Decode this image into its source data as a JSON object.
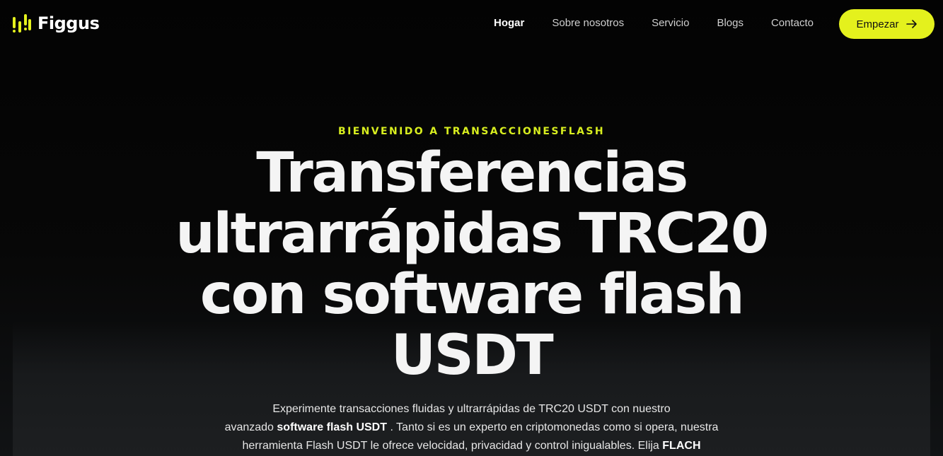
{
  "brand": {
    "name": "Figgus",
    "accent_color": "#E4F11D",
    "logo_icon": "bars-logo-icon"
  },
  "nav": {
    "items": [
      {
        "label": "Hogar",
        "active": true
      },
      {
        "label": "Sobre nosotros",
        "active": false
      },
      {
        "label": "Servicio",
        "active": false
      },
      {
        "label": "Blogs",
        "active": false
      },
      {
        "label": "Contacto",
        "active": false
      }
    ],
    "cta": {
      "label": "Empezar",
      "icon": "arrow-right-icon"
    }
  },
  "hero": {
    "eyebrow": "BIENVENIDO A TRANSACCIONESFLASH",
    "title_lines": [
      "Transferencias",
      "ultrarrápidas TRC20",
      "con software flash",
      "USDT"
    ],
    "description": {
      "line1": "Experimente transacciones fluidas y ultrarrápidas de TRC20 USDT con nuestro",
      "line2_pre": "avanzado ",
      "line2_bold": "software flash USDT",
      "line2_post": " . Tanto si es un experto en criptomonedas como si opera, nuestra",
      "line3_pre": "herramienta Flash USDT le ofrece velocidad, privacidad y control inigualables. Elija ",
      "line3_bold": "FLACH"
    }
  }
}
